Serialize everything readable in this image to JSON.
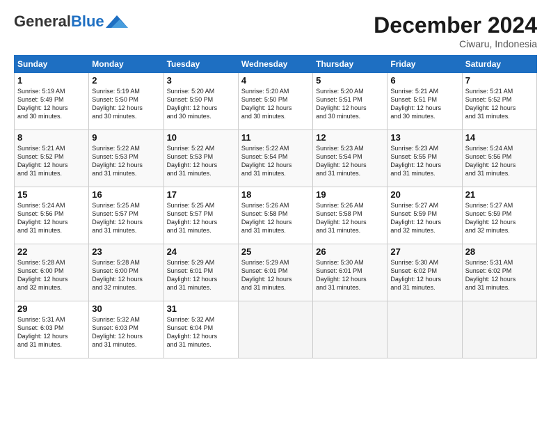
{
  "header": {
    "logo_general": "General",
    "logo_blue": "Blue",
    "month_title": "December 2024",
    "location": "Ciwaru, Indonesia"
  },
  "weekdays": [
    "Sunday",
    "Monday",
    "Tuesday",
    "Wednesday",
    "Thursday",
    "Friday",
    "Saturday"
  ],
  "weeks": [
    [
      {
        "day": "1",
        "lines": [
          "Sunrise: 5:19 AM",
          "Sunset: 5:49 PM",
          "Daylight: 12 hours",
          "and 30 minutes."
        ]
      },
      {
        "day": "2",
        "lines": [
          "Sunrise: 5:19 AM",
          "Sunset: 5:50 PM",
          "Daylight: 12 hours",
          "and 30 minutes."
        ]
      },
      {
        "day": "3",
        "lines": [
          "Sunrise: 5:20 AM",
          "Sunset: 5:50 PM",
          "Daylight: 12 hours",
          "and 30 minutes."
        ]
      },
      {
        "day": "4",
        "lines": [
          "Sunrise: 5:20 AM",
          "Sunset: 5:50 PM",
          "Daylight: 12 hours",
          "and 30 minutes."
        ]
      },
      {
        "day": "5",
        "lines": [
          "Sunrise: 5:20 AM",
          "Sunset: 5:51 PM",
          "Daylight: 12 hours",
          "and 30 minutes."
        ]
      },
      {
        "day": "6",
        "lines": [
          "Sunrise: 5:21 AM",
          "Sunset: 5:51 PM",
          "Daylight: 12 hours",
          "and 30 minutes."
        ]
      },
      {
        "day": "7",
        "lines": [
          "Sunrise: 5:21 AM",
          "Sunset: 5:52 PM",
          "Daylight: 12 hours",
          "and 31 minutes."
        ]
      }
    ],
    [
      {
        "day": "8",
        "lines": [
          "Sunrise: 5:21 AM",
          "Sunset: 5:52 PM",
          "Daylight: 12 hours",
          "and 31 minutes."
        ]
      },
      {
        "day": "9",
        "lines": [
          "Sunrise: 5:22 AM",
          "Sunset: 5:53 PM",
          "Daylight: 12 hours",
          "and 31 minutes."
        ]
      },
      {
        "day": "10",
        "lines": [
          "Sunrise: 5:22 AM",
          "Sunset: 5:53 PM",
          "Daylight: 12 hours",
          "and 31 minutes."
        ]
      },
      {
        "day": "11",
        "lines": [
          "Sunrise: 5:22 AM",
          "Sunset: 5:54 PM",
          "Daylight: 12 hours",
          "and 31 minutes."
        ]
      },
      {
        "day": "12",
        "lines": [
          "Sunrise: 5:23 AM",
          "Sunset: 5:54 PM",
          "Daylight: 12 hours",
          "and 31 minutes."
        ]
      },
      {
        "day": "13",
        "lines": [
          "Sunrise: 5:23 AM",
          "Sunset: 5:55 PM",
          "Daylight: 12 hours",
          "and 31 minutes."
        ]
      },
      {
        "day": "14",
        "lines": [
          "Sunrise: 5:24 AM",
          "Sunset: 5:56 PM",
          "Daylight: 12 hours",
          "and 31 minutes."
        ]
      }
    ],
    [
      {
        "day": "15",
        "lines": [
          "Sunrise: 5:24 AM",
          "Sunset: 5:56 PM",
          "Daylight: 12 hours",
          "and 31 minutes."
        ]
      },
      {
        "day": "16",
        "lines": [
          "Sunrise: 5:25 AM",
          "Sunset: 5:57 PM",
          "Daylight: 12 hours",
          "and 31 minutes."
        ]
      },
      {
        "day": "17",
        "lines": [
          "Sunrise: 5:25 AM",
          "Sunset: 5:57 PM",
          "Daylight: 12 hours",
          "and 31 minutes."
        ]
      },
      {
        "day": "18",
        "lines": [
          "Sunrise: 5:26 AM",
          "Sunset: 5:58 PM",
          "Daylight: 12 hours",
          "and 31 minutes."
        ]
      },
      {
        "day": "19",
        "lines": [
          "Sunrise: 5:26 AM",
          "Sunset: 5:58 PM",
          "Daylight: 12 hours",
          "and 31 minutes."
        ]
      },
      {
        "day": "20",
        "lines": [
          "Sunrise: 5:27 AM",
          "Sunset: 5:59 PM",
          "Daylight: 12 hours",
          "and 32 minutes."
        ]
      },
      {
        "day": "21",
        "lines": [
          "Sunrise: 5:27 AM",
          "Sunset: 5:59 PM",
          "Daylight: 12 hours",
          "and 32 minutes."
        ]
      }
    ],
    [
      {
        "day": "22",
        "lines": [
          "Sunrise: 5:28 AM",
          "Sunset: 6:00 PM",
          "Daylight: 12 hours",
          "and 32 minutes."
        ]
      },
      {
        "day": "23",
        "lines": [
          "Sunrise: 5:28 AM",
          "Sunset: 6:00 PM",
          "Daylight: 12 hours",
          "and 32 minutes."
        ]
      },
      {
        "day": "24",
        "lines": [
          "Sunrise: 5:29 AM",
          "Sunset: 6:01 PM",
          "Daylight: 12 hours",
          "and 31 minutes."
        ]
      },
      {
        "day": "25",
        "lines": [
          "Sunrise: 5:29 AM",
          "Sunset: 6:01 PM",
          "Daylight: 12 hours",
          "and 31 minutes."
        ]
      },
      {
        "day": "26",
        "lines": [
          "Sunrise: 5:30 AM",
          "Sunset: 6:01 PM",
          "Daylight: 12 hours",
          "and 31 minutes."
        ]
      },
      {
        "day": "27",
        "lines": [
          "Sunrise: 5:30 AM",
          "Sunset: 6:02 PM",
          "Daylight: 12 hours",
          "and 31 minutes."
        ]
      },
      {
        "day": "28",
        "lines": [
          "Sunrise: 5:31 AM",
          "Sunset: 6:02 PM",
          "Daylight: 12 hours",
          "and 31 minutes."
        ]
      }
    ],
    [
      {
        "day": "29",
        "lines": [
          "Sunrise: 5:31 AM",
          "Sunset: 6:03 PM",
          "Daylight: 12 hours",
          "and 31 minutes."
        ]
      },
      {
        "day": "30",
        "lines": [
          "Sunrise: 5:32 AM",
          "Sunset: 6:03 PM",
          "Daylight: 12 hours",
          "and 31 minutes."
        ]
      },
      {
        "day": "31",
        "lines": [
          "Sunrise: 5:32 AM",
          "Sunset: 6:04 PM",
          "Daylight: 12 hours",
          "and 31 minutes."
        ]
      },
      null,
      null,
      null,
      null
    ]
  ]
}
